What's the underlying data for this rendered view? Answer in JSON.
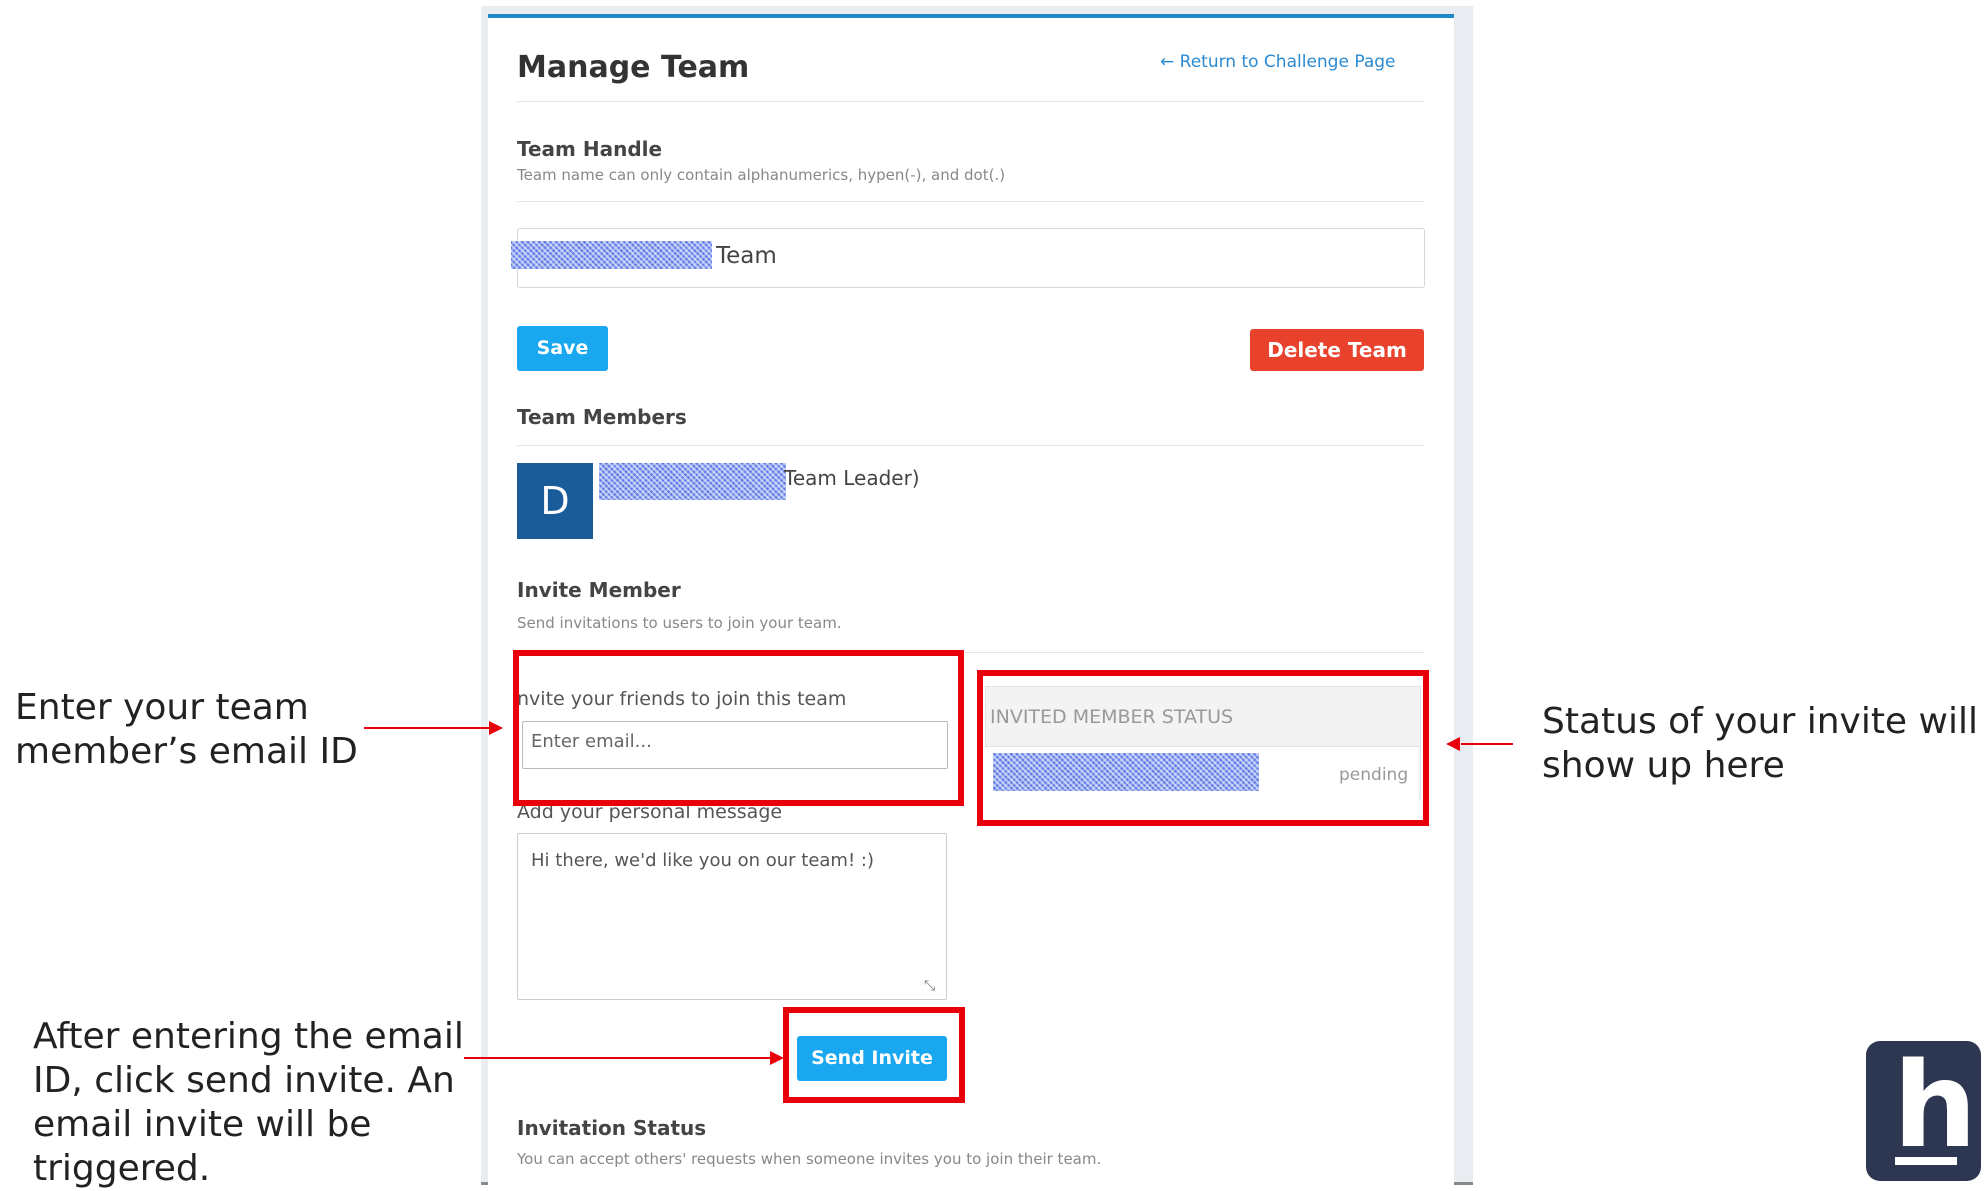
{
  "page": {
    "title": "Manage Team",
    "return_link": "← Return to Challenge Page"
  },
  "team_handle": {
    "label": "Team Handle",
    "hint": "Team name can only contain alphanumerics, hypen(-), and dot(.)",
    "value_suffix": "Team",
    "save_label": "Save",
    "delete_label": "Delete Team"
  },
  "members": {
    "label": "Team Members",
    "avatar_letter": "D",
    "leader_text": "Team Leader)"
  },
  "invite": {
    "label": "Invite Member",
    "hint": "Send invitations to users to join your team.",
    "friends_label": "nvite your friends to join this team",
    "email_placeholder": "Enter email...",
    "message_label": "Add your personal message",
    "message_value": "Hi there, we'd like you on our team! :)",
    "send_label": "Send Invite"
  },
  "invited_status": {
    "header": "INVITED MEMBER STATUS",
    "status": "pending"
  },
  "invitation_status": {
    "label": "Invitation Status",
    "hint": "You can accept others' requests when someone invites you to join their team."
  },
  "annotations": {
    "email_note": [
      "Enter your team",
      "member’s email ID"
    ],
    "status_note": [
      "Status of your invite will",
      "show up here"
    ],
    "send_note": [
      "After entering the email",
      "ID, click send invite. An",
      "email invite will be",
      "triggered."
    ]
  },
  "colors": {
    "accent": "#19a8f0",
    "danger": "#e8412c",
    "highlight": "#e8000b",
    "avatar": "#1a5b9a",
    "logo": "#2e3751"
  },
  "icons": {
    "logo": "h-logo-icon",
    "return": "left-arrow-icon",
    "resize": "resize-handle-icon"
  }
}
